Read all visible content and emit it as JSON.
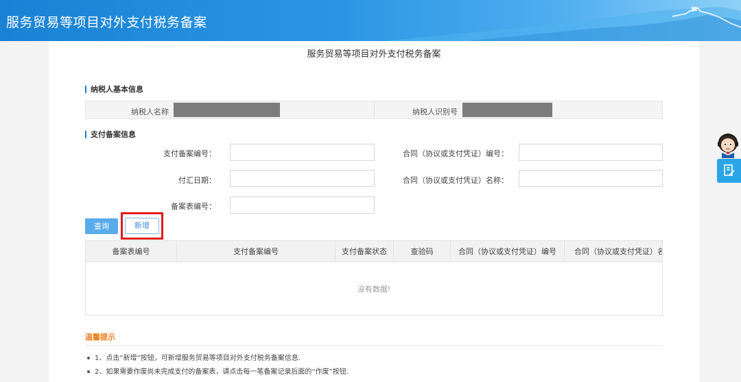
{
  "header": {
    "title": "服务贸易等项目对外支付税务备案"
  },
  "page": {
    "title": "服务贸易等项目对外支付税务备案"
  },
  "taxpayer_section": {
    "title": "纳税人基本信息",
    "name_label": "纳税人名称",
    "id_label": "纳税人识别号"
  },
  "payment_section": {
    "title": "支付备案信息",
    "fields": {
      "payment_record_no": "支付备案编号：",
      "contract_no": "合同（协议或支付凭证）编号：",
      "remit_date": "付汇日期：",
      "contract_name": "合同（协议或支付凭证）名称：",
      "form_no": "备案表编号："
    }
  },
  "buttons": {
    "query": "查询",
    "add": "新增"
  },
  "table": {
    "columns": [
      "备案表编号",
      "支付备案编号",
      "支付备案状态",
      "查验码",
      "合同（协议或支付凭证）编号",
      "合同（协议或支付凭证）名"
    ],
    "empty_text": "没有数据!"
  },
  "tips": {
    "title": "温馨提示",
    "items": [
      "1、点击“新增”按钮，可新增服务贸易等项目对外支付税务备案信息.",
      "2、如果需要作废尚未完成支付的备案表，请点击每一笔备案记录后面的“作废”按钮."
    ]
  },
  "side": {
    "icon": "document-icon"
  },
  "colors": {
    "header": "#1a82d4",
    "accent": "#5aabea",
    "highlight": "#e11b1b",
    "tips": "#f07d1a"
  }
}
